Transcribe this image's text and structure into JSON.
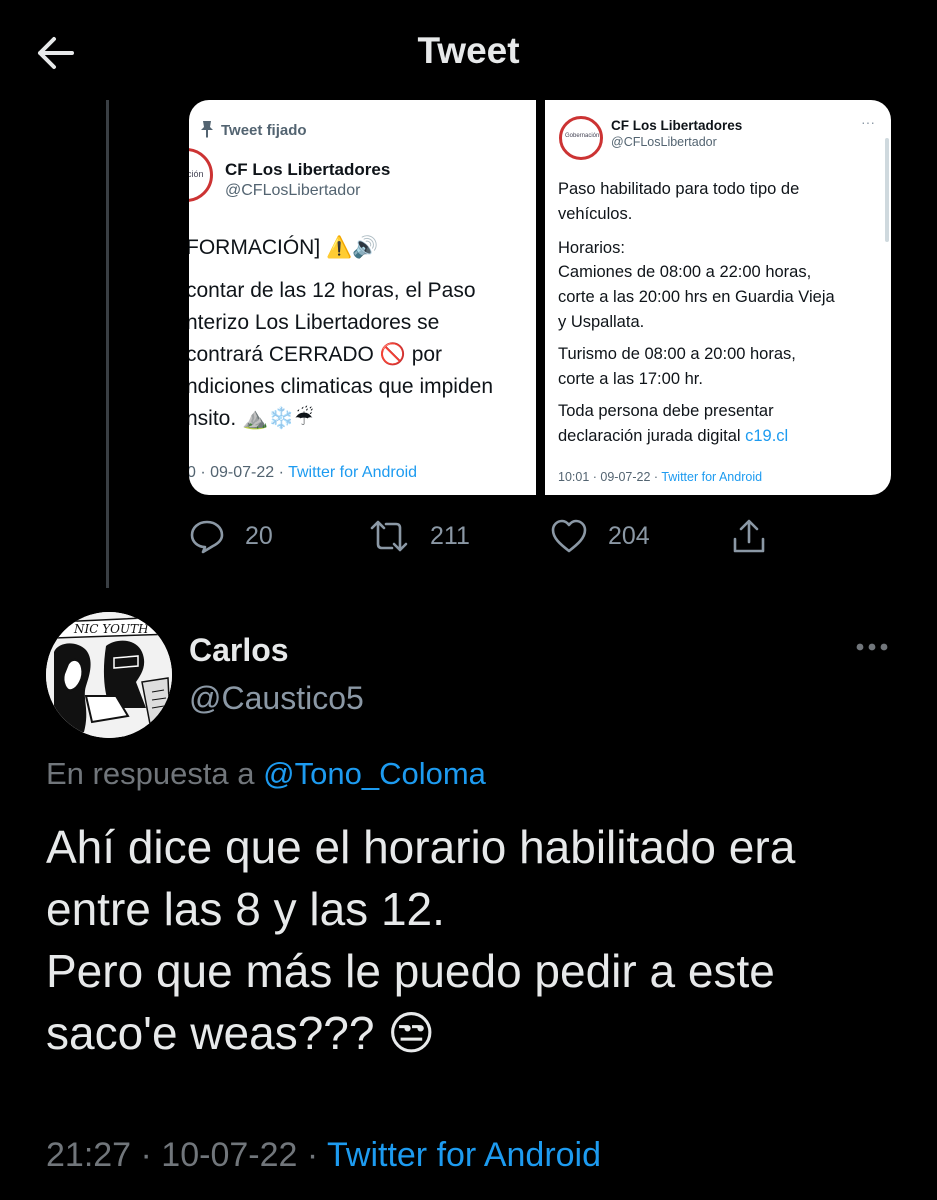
{
  "header": {
    "title": "Tweet"
  },
  "quoted_images": {
    "left": {
      "pinned_label": "Tweet fijado",
      "account_name": "CF Los Libertadores",
      "account_handle": "@CFLosLibertador",
      "avatar_text": "ación",
      "lines": [
        "FORMACIÓN] ⚠️🔊",
        "contar de las 12 horas, el Paso",
        "nterizo Los Libertadores se",
        "contrará CERRADO 🚫 por",
        "ndiciones climaticas que impiden",
        "nsito. ⛰️❄️☔"
      ],
      "meta_time": "0 · 09-07-22 · ",
      "meta_source": "Twitter for Android"
    },
    "right": {
      "account_name": "CF Los Libertadores",
      "account_handle": "@CFLosLibertador",
      "avatar_text": "Gobernación",
      "more": "···",
      "paragraphs": [
        {
          "lines": [
            "Paso habilitado para todo tipo de",
            "vehículos."
          ]
        },
        {
          "lines": [
            "Horarios:",
            "Camiones de 08:00 a 22:00 horas,",
            "corte a las 20:00 hrs en Guardia Vieja",
            "y Uspallata."
          ]
        },
        {
          "lines": [
            "Turismo de 08:00 a 20:00 horas,",
            "corte a las 17:00 hr."
          ]
        },
        {
          "lines": [
            "Toda persona debe presentar"
          ],
          "last_line_text": "declaración jurada digital ",
          "last_line_link": "c19.cl"
        }
      ],
      "meta_time": "10:01 · 09-07-22 · ",
      "meta_source": "Twitter for Android"
    }
  },
  "actions": {
    "reply_icon": "reply-icon",
    "reply_count": "20",
    "retweet_icon": "retweet-icon",
    "retweet_count": "211",
    "like_icon": "heart-icon",
    "like_count": "204",
    "share_icon": "share-icon"
  },
  "reply": {
    "avatar_text": "NIC YOUTH",
    "name": "Carlos",
    "handle": "@Caustico5",
    "more": "···",
    "reply_to_label": "En respuesta a ",
    "reply_to_mention": "@Tono_Coloma",
    "body_lines": [
      "Ahí dice que el horario habilitado era",
      "entre las 8 y las 12.",
      "Pero que más le puedo pedir a este",
      "saco'e weas??? 😒"
    ],
    "timestamp": "21:27 · 10-07-22 · ",
    "source": "Twitter for Android"
  },
  "colors": {
    "background": "#000000",
    "accent": "#1d9bf0",
    "muted": "#71767b"
  }
}
